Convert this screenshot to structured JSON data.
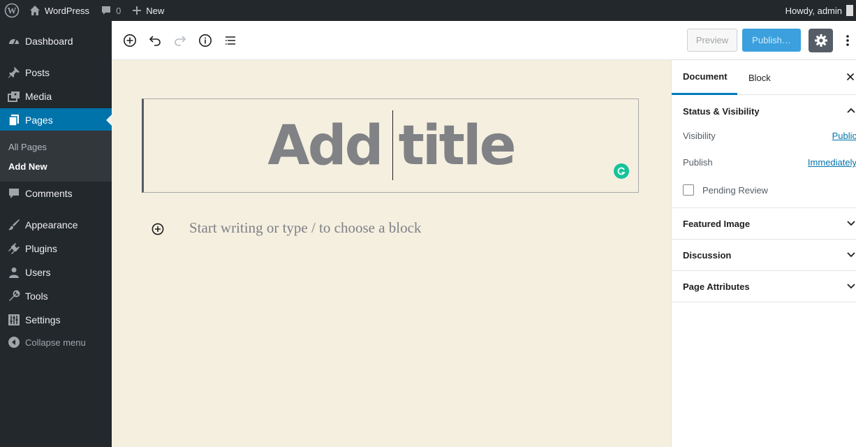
{
  "adminbar": {
    "site_name": "WordPress",
    "comments_count": "0",
    "new_label": "New",
    "greeting": "Howdy, admin"
  },
  "sidebar": {
    "items": [
      {
        "label": "Dashboard",
        "icon": "dashboard-icon"
      },
      {
        "label": "Posts",
        "icon": "pin-icon"
      },
      {
        "label": "Media",
        "icon": "media-icon"
      },
      {
        "label": "Pages",
        "icon": "pages-icon"
      },
      {
        "label": "Comments",
        "icon": "comment-icon"
      },
      {
        "label": "Appearance",
        "icon": "brush-icon"
      },
      {
        "label": "Plugins",
        "icon": "plugin-icon"
      },
      {
        "label": "Users",
        "icon": "user-icon"
      },
      {
        "label": "Tools",
        "icon": "wrench-icon"
      },
      {
        "label": "Settings",
        "icon": "settings-sliders-icon"
      }
    ],
    "current": "Pages",
    "submenu": [
      "All Pages",
      "Add New"
    ],
    "submenu_active": "Add New",
    "collapse_label": "Collapse menu"
  },
  "toolbar": {
    "preview_label": "Preview",
    "publish_label": "Publish…"
  },
  "editor": {
    "title_placeholder": "Add title",
    "block_placeholder": "Start writing or type / to choose a block"
  },
  "settings_panel": {
    "tabs": [
      "Document",
      "Block"
    ],
    "active_tab": "Document",
    "status_visibility": {
      "heading": "Status & Visibility",
      "visibility_label": "Visibility",
      "visibility_value": "Public",
      "publish_label": "Publish",
      "publish_value": "Immediately",
      "pending_review_label": "Pending Review",
      "pending_review_checked": false
    },
    "sections": [
      "Featured Image",
      "Discussion",
      "Page Attributes"
    ]
  },
  "colors": {
    "admin_dark": "#23282d",
    "accent_blue": "#0073aa",
    "canvas_bg": "#f5efe0",
    "grammarly_green": "#15c39a"
  }
}
